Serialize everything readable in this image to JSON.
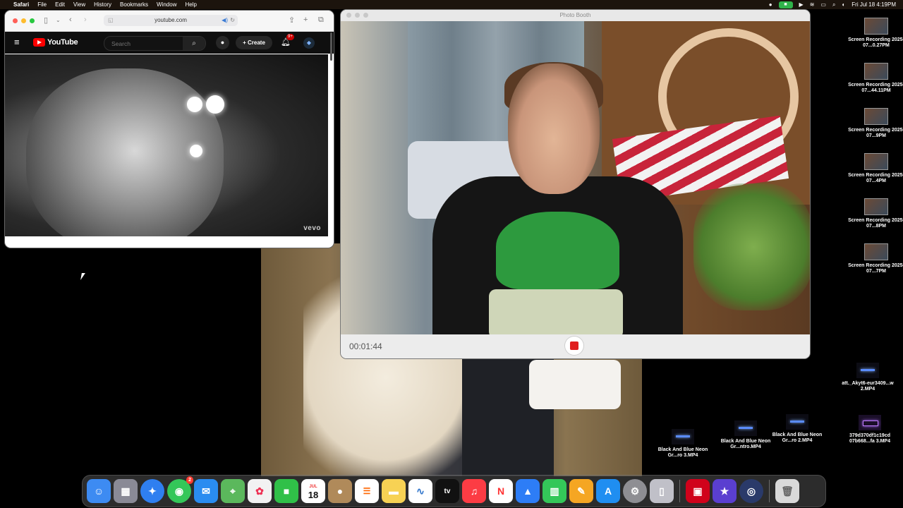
{
  "menubar": {
    "app_name": "Safari",
    "items": [
      "File",
      "Edit",
      "View",
      "History",
      "Bookmarks",
      "Window",
      "Help"
    ],
    "datetime": "Fri Jul 18  4:19PM"
  },
  "safari": {
    "url": "youtube.com",
    "youtube": {
      "logo_text": "YouTube",
      "search_placeholder": "Search",
      "create_label": "Create",
      "notification_count": "9+",
      "watermark": "vevo"
    }
  },
  "photobooth": {
    "title": "Photo Booth",
    "timer": "00:01:44"
  },
  "desktop_icons": [
    {
      "label": "Screen Recording 2025-07...0.27PM",
      "kind": "photo"
    },
    {
      "label": "Screen Recording 2025-07...44.11PM",
      "kind": "photo"
    },
    {
      "label": "Screen Recording 2025-07...9PM",
      "kind": "photo"
    },
    {
      "label": "Screen Recording 2025-07...4PM",
      "kind": "photo"
    },
    {
      "label": "Screen Recording 2025-07...8PM",
      "kind": "photo"
    },
    {
      "label": "Screen Recording 2025-07...7PM",
      "kind": "photo"
    },
    {
      "label": "att._Akyt6-eur3409...w 2.MP4",
      "kind": "neon"
    },
    {
      "label": "379d370df1c19cd 07b668...fa 3.MP4",
      "kind": "purple"
    },
    {
      "label": "Black And Blue Neon Gr...ro 2.MP4",
      "kind": "neon"
    },
    {
      "label": "Black And Blue Neon Gr...ntro.MP4",
      "kind": "neon"
    },
    {
      "label": "Black And Blue Neon Gr...ro 3.MP4",
      "kind": "neon"
    }
  ],
  "dock": {
    "calendar_month": "JUL",
    "calendar_day": "18",
    "messages_badge": "2",
    "apps": [
      {
        "name": "Finder",
        "icon": "finder-icon",
        "color": "#3d8bf2"
      },
      {
        "name": "Launchpad",
        "icon": "launchpad-icon",
        "color": "#8a8a96"
      },
      {
        "name": "Safari",
        "icon": "safari-icon",
        "color": "#2f7ff0"
      },
      {
        "name": "Messages",
        "icon": "messages-icon",
        "color": "#34c759"
      },
      {
        "name": "Mail",
        "icon": "mail-icon",
        "color": "#2a8cf0"
      },
      {
        "name": "Maps",
        "icon": "maps-icon",
        "color": "#5bb85c"
      },
      {
        "name": "Photos",
        "icon": "photos-icon",
        "color": "#f2f2f2"
      },
      {
        "name": "FaceTime",
        "icon": "facetime-icon",
        "color": "#30c048"
      },
      {
        "name": "Calendar",
        "icon": "calendar-icon",
        "color": "#ffffff"
      },
      {
        "name": "Contacts",
        "icon": "contacts-icon",
        "color": "#b08a5a"
      },
      {
        "name": "Reminders",
        "icon": "reminders-icon",
        "color": "#ffffff"
      },
      {
        "name": "Notes",
        "icon": "notes-icon",
        "color": "#f7d254"
      },
      {
        "name": "Freeform",
        "icon": "freeform-icon",
        "color": "#ffffff"
      },
      {
        "name": "TV",
        "icon": "tv-icon",
        "color": "#111111"
      },
      {
        "name": "Music",
        "icon": "music-icon",
        "color": "#fc3c44"
      },
      {
        "name": "News",
        "icon": "news-icon",
        "color": "#ffffff"
      },
      {
        "name": "Keynote",
        "icon": "keynote-icon",
        "color": "#2d7df6"
      },
      {
        "name": "Numbers",
        "icon": "numbers-icon",
        "color": "#34c759"
      },
      {
        "name": "Pages",
        "icon": "pages-icon",
        "color": "#f5a623"
      },
      {
        "name": "App Store",
        "icon": "app-store-icon",
        "color": "#1f8ef1"
      },
      {
        "name": "System Settings",
        "icon": "settings-icon",
        "color": "#8e8e93"
      },
      {
        "name": "iPhone Mirroring",
        "icon": "iphone-mirroring-icon",
        "color": "#c0c0c8"
      },
      {
        "name": "Photo Booth",
        "icon": "photo-booth-icon",
        "color": "#d0021b"
      },
      {
        "name": "iMovie",
        "icon": "imovie-icon",
        "color": "#5a3fd0"
      },
      {
        "name": "QuickTime Player",
        "icon": "quicktime-icon",
        "color": "#2a3a6a"
      },
      {
        "name": "Trash",
        "icon": "trash-icon",
        "color": "#d9d9d9"
      }
    ]
  }
}
